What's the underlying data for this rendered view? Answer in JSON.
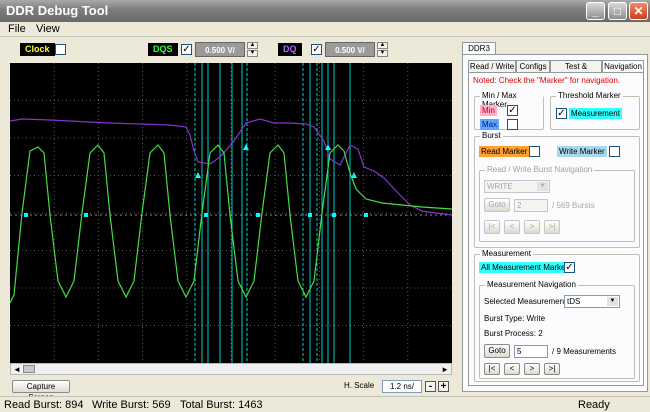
{
  "window": {
    "title": "DDR Debug Tool",
    "buttons": {
      "minimize": "_",
      "maximize": "□",
      "close": "✕"
    }
  },
  "menu": {
    "file": "File",
    "view": "View"
  },
  "controls": {
    "clock": {
      "label": "Clock",
      "color": "#ffff33",
      "checked": ""
    },
    "dqs": {
      "label": "DQS",
      "color": "#33ff33",
      "checked": "✓",
      "volt": "0.500 V/"
    },
    "dq": {
      "label": "DQ",
      "color": "#a050ff",
      "checked": "✓",
      "volt": "0.500 V/"
    },
    "spin_up": "▲",
    "spin_down": "▼"
  },
  "scope": {
    "colors": {
      "dqs": "#44dd44",
      "dq": "#8833cc",
      "marker": "#00ffff",
      "grid": "#5a5a5a"
    }
  },
  "bottom": {
    "capture_button": "Capture Screen",
    "hscale_label": "H. Scale",
    "hscale_value": "1.2 ns/",
    "minus": "-",
    "plus": "+",
    "scroll_left": "◄",
    "scroll_right": "►"
  },
  "status": {
    "read_burst": "Read Burst: 894",
    "write_burst": "Write Burst: 569",
    "total_burst": "Total Burst: 1463",
    "state": "Ready"
  },
  "panel": {
    "outer_tab": "DDR3",
    "tabs": [
      "Read / Write",
      "Configs",
      "Test & Results",
      "Navigation"
    ],
    "note": "Noted: Check the \"Marker\" for navigation.",
    "minmax": {
      "title": "Min / Max Marker",
      "min_label": "Min",
      "min_checked": "✓",
      "max_label": "Max",
      "max_checked": ""
    },
    "threshold": {
      "title": "Threshold Marker",
      "checked": "✓",
      "label": "Measurement"
    },
    "burst": {
      "title": "Burst",
      "read_marker": "Read Marker",
      "read_checked": "",
      "write_marker": "Write Marker",
      "write_checked": "",
      "nav_title": "Read / Write Burst Navigation",
      "dropdown_value": "WRITE",
      "goto": "Goto",
      "goto_value": "2",
      "of_text": "/ 569 Bursts",
      "nav_first": "|<",
      "nav_prev": "<",
      "nav_next": ">",
      "nav_last": ">|"
    },
    "measurement": {
      "title": "Measurement",
      "all_marker": "All Measurement Marker",
      "all_checked": "✓",
      "nav_title": "Measurement Navigation",
      "selected_label": "Selected Measurement:",
      "selected_value": "tDS",
      "burst_type": "Burst Type: Write",
      "burst_process": "Burst Process: 2",
      "goto": "Goto",
      "goto_value": "5",
      "of_text": "/ 9 Measurements",
      "nav_first": "|<",
      "nav_prev": "<",
      "nav_next": ">",
      "nav_last": ">|"
    }
  }
}
